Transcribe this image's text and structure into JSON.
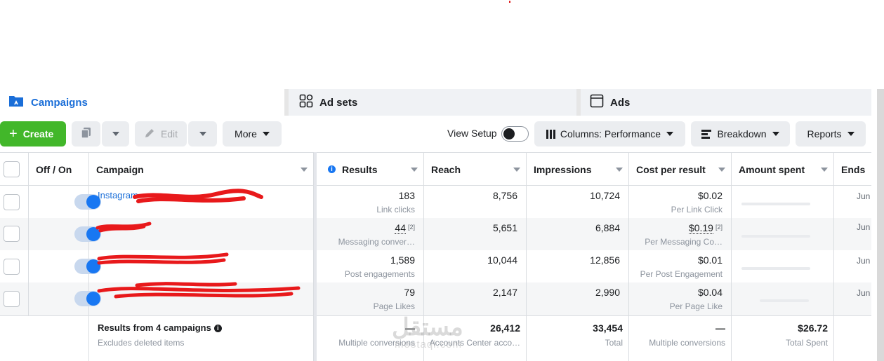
{
  "tabs": {
    "campaigns": "Campaigns",
    "adsets": "Ad sets",
    "ads": "Ads"
  },
  "toolbar": {
    "create": "Create",
    "edit": "Edit",
    "more": "More",
    "view_setup": "View Setup",
    "columns": "Columns: Performance",
    "breakdown": "Breakdown",
    "reports": "Reports"
  },
  "table": {
    "headers": {
      "off_on": "Off / On",
      "campaign": "Campaign",
      "results": "Results",
      "reach": "Reach",
      "impressions": "Impressions",
      "cost_per_result": "Cost per result",
      "amount_spent": "Amount spent",
      "ends": "Ends"
    },
    "rows": [
      {
        "campaign": "Instagram",
        "results": "183",
        "results_type": "Link clicks",
        "reach": "8,756",
        "impressions": "10,724",
        "cost": "$0.02",
        "cost_type": "Per Link Click",
        "ends": "Jun"
      },
      {
        "campaign": "",
        "results": "44",
        "results_ref": "[2]",
        "results_type": "Messaging conver…",
        "reach": "5,651",
        "impressions": "6,884",
        "cost": "$0.19",
        "cost_ref": "[2]",
        "cost_type": "Per Messaging Co…",
        "ends": "Jun"
      },
      {
        "campaign": "",
        "results": "1,589",
        "results_type": "Post engagements",
        "reach": "10,044",
        "impressions": "12,856",
        "cost": "$0.01",
        "cost_type": "Per Post Engagement",
        "ends": "Jun"
      },
      {
        "campaign": "",
        "results": "79",
        "results_type": "Page Likes",
        "reach": "2,147",
        "impressions": "2,990",
        "cost": "$0.04",
        "cost_type": "Per Page Like",
        "ends": "Jun"
      }
    ],
    "totals": {
      "label": "Results from 4 campaigns",
      "sub": "Excludes deleted items",
      "results": "—",
      "results_sub": "Multiple conversions",
      "reach": "26,412",
      "reach_sub": "Accounts Center acco…",
      "impressions": "33,454",
      "impressions_sub": "Total",
      "cost": "—",
      "cost_sub": "Multiple conversions",
      "spent": "$26.72",
      "spent_sub": "Total Spent"
    }
  },
  "watermark": {
    "arabic": "مستقل",
    "latin": "mostaql.com"
  },
  "colors": {
    "accent": "#1a6ed8",
    "create": "#42b72a",
    "toggle": "#1877f2",
    "redaction": "#e8191b"
  }
}
